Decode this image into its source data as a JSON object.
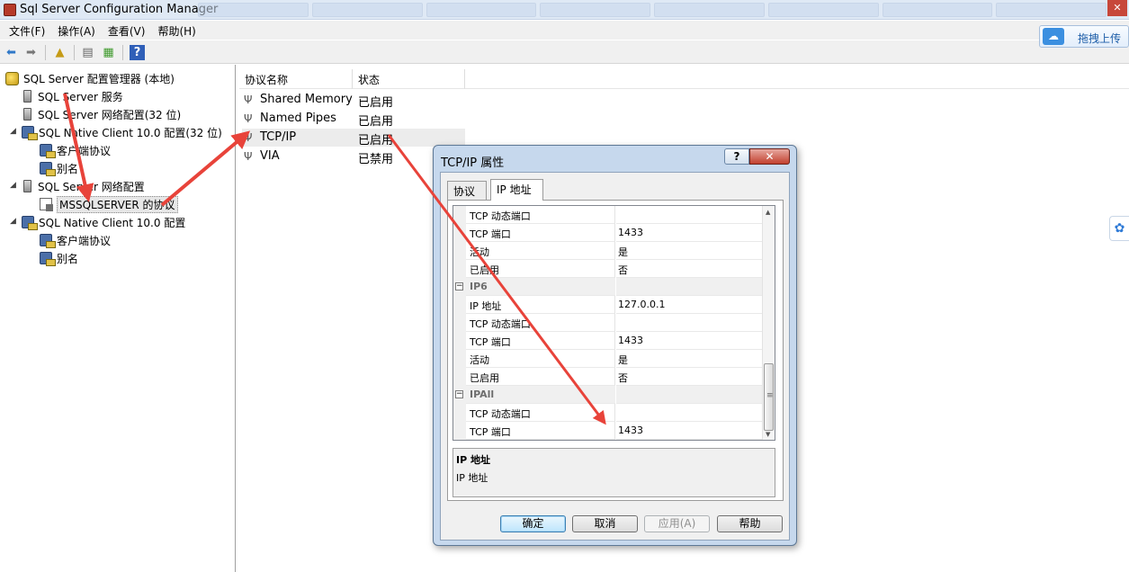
{
  "window": {
    "title": "Sql Server Configuration Manager",
    "close_glyph": "✕"
  },
  "menu": [
    "文件(F)",
    "操作(A)",
    "查看(V)",
    "帮助(H)"
  ],
  "toolbar": {
    "upload_label": "拖拽上传"
  },
  "tree": {
    "root": "SQL Server 配置管理器 (本地)",
    "services": "SQL Server 服务",
    "net32": "SQL Server 网络配置(32 位)",
    "native32": "SQL Native Client 10.0 配置(32 位)",
    "native32_client": "客户端协议",
    "native32_alias": "别名",
    "net": "SQL Server 网络配置",
    "mssql": "MSSQLSERVER 的协议",
    "native": "SQL Native Client 10.0 配置",
    "native_client": "客户端协议",
    "native_alias": "别名"
  },
  "list": {
    "col_name": "协议名称",
    "col_status": "状态",
    "rows": [
      {
        "name": "Shared Memory",
        "status": "已启用"
      },
      {
        "name": "Named Pipes",
        "status": "已启用"
      },
      {
        "name": "TCP/IP",
        "status": "已启用"
      },
      {
        "name": "VIA",
        "status": "已禁用"
      }
    ]
  },
  "dialog": {
    "title": "TCP/IP 属性",
    "help_glyph": "?",
    "close_glyph": "✕",
    "tabs": [
      "协议",
      "IP 地址"
    ],
    "grid": [
      {
        "k": "TCP 动态端口",
        "v": ""
      },
      {
        "k": "TCP 端口",
        "v": "1433"
      },
      {
        "k": "活动",
        "v": "是"
      },
      {
        "k": "已启用",
        "v": "否"
      },
      {
        "k": "IP6",
        "v": ""
      },
      {
        "k": "IP 地址",
        "v": "127.0.0.1"
      },
      {
        "k": "TCP 动态端口",
        "v": ""
      },
      {
        "k": "TCP 端口",
        "v": "1433"
      },
      {
        "k": "活动",
        "v": "是"
      },
      {
        "k": "已启用",
        "v": "否"
      },
      {
        "k": "IPAll",
        "v": ""
      },
      {
        "k": "TCP 动态端口",
        "v": ""
      },
      {
        "k": "TCP 端口",
        "v": "1433"
      }
    ],
    "collapse_glyph": "−",
    "desc_title": "IP 地址",
    "desc_text": "IP 地址",
    "buttons": {
      "ok": "确定",
      "cancel": "取消",
      "apply": "应用(A)",
      "help": "帮助"
    }
  },
  "accent_colors": {
    "annotation_arrow": "#e8433a",
    "default_button": "#3c7fb1"
  }
}
